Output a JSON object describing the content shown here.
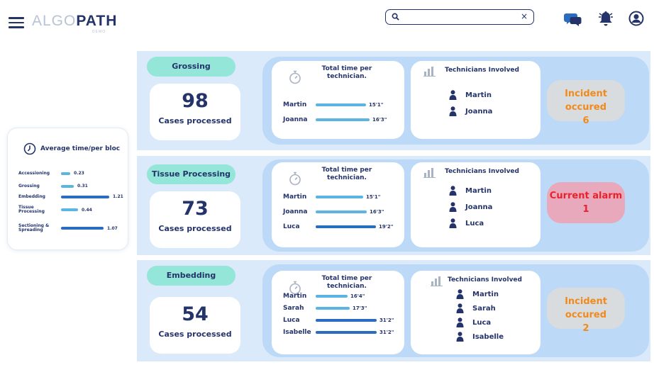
{
  "header": {
    "logo_part1": "ALGO",
    "logo_part2": "PATH",
    "logo_tag": "DEMO",
    "search_placeholder": "",
    "search_clear": "×"
  },
  "icons": {
    "menu": "hamburger-icon",
    "search": "search-icon",
    "chat": "chat-support-icon",
    "notifications": "bell-icon",
    "profile": "user-profile-icon",
    "clock": "clock-icon",
    "stopwatch": "stopwatch-icon",
    "bar_chart": "bar-chart-icon",
    "person": "person-icon"
  },
  "colors": {
    "navy": "#24346b",
    "teal_pill": "#93e6d8",
    "light_bar": "#5cb4e3",
    "dark_bar": "#2a6cc0",
    "section_bg": "#dbeafb",
    "panel_bg": "#bcd9f8",
    "incident_orange": "#f08a1d",
    "alarm_red": "#e8222b",
    "alarm_bg": "#e9a9bc"
  },
  "average": {
    "title": "Average time/per bloc",
    "rows": [
      {
        "label": "Accessioning",
        "value": "0.23",
        "fraction": 0.19
      },
      {
        "label": "Grossing",
        "value": "0.31",
        "fraction": 0.26
      },
      {
        "label": "Embedding",
        "value": "1.21",
        "fraction": 1.0
      },
      {
        "label": "Tissue Processing",
        "value": "0.44",
        "fraction": 0.36
      },
      {
        "label": "Sectioning & Spreading",
        "value": "1.07",
        "fraction": 0.88
      }
    ]
  },
  "time_card_title": "Total time per technician.",
  "tech_card_title": "Technicians Involved",
  "cases_label": "Cases processed",
  "sections": [
    {
      "stage": "Grossing",
      "cases": "98",
      "times": [
        {
          "name": "Martin",
          "time": "15'1\"",
          "fraction": 0.82
        },
        {
          "name": "Joanna",
          "time": "16'3\"",
          "fraction": 0.88
        }
      ],
      "technicians": [
        "Martin",
        "Joanna"
      ],
      "status": {
        "kind": "incident",
        "label": "Incident occured",
        "count": "6"
      }
    },
    {
      "stage": "Tissue Processing",
      "cases": "73",
      "times": [
        {
          "name": "Martin",
          "time": "15'1\"",
          "fraction": 0.78
        },
        {
          "name": "Joanna",
          "time": "16'3\"",
          "fraction": 0.84
        },
        {
          "name": "Luca",
          "time": "19'2\"",
          "fraction": 0.99
        }
      ],
      "technicians": [
        "Martin",
        "Joanna",
        "Luca"
      ],
      "status": {
        "kind": "alarm",
        "label": "Current alarm",
        "count": "1"
      }
    },
    {
      "stage": "Embedding",
      "cases": "54",
      "times": [
        {
          "name": "Martin",
          "time": "16'4\"",
          "fraction": 0.52
        },
        {
          "name": "Sarah",
          "time": "17'3\"",
          "fraction": 0.56
        },
        {
          "name": "Luca",
          "time": "31'2\"",
          "fraction": 1.0
        },
        {
          "name": "Isabelle",
          "time": "31'2\"",
          "fraction": 1.0
        }
      ],
      "technicians": [
        "Martin",
        "Sarah",
        "Luca",
        "Isabelle"
      ],
      "status": {
        "kind": "incident",
        "label": "Incident occured",
        "count": "2"
      }
    }
  ]
}
